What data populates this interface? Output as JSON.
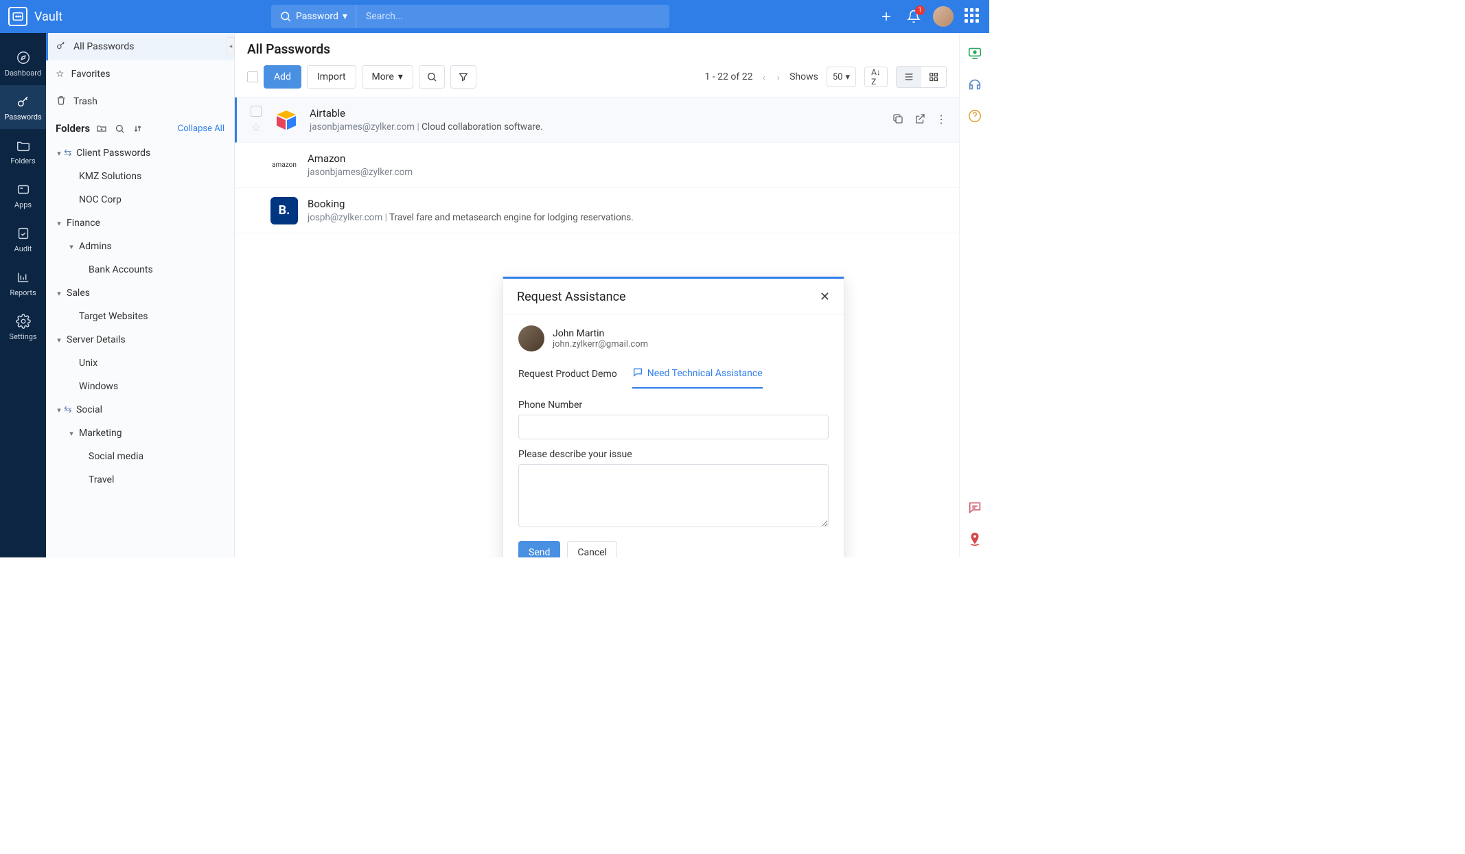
{
  "app": {
    "name": "Vault"
  },
  "search": {
    "type_label": "Password",
    "placeholder": "Search..."
  },
  "topbar": {
    "notification_count": "1"
  },
  "nav_rail": [
    {
      "label": "Dashboard"
    },
    {
      "label": "Passwords"
    },
    {
      "label": "Folders"
    },
    {
      "label": "Apps"
    },
    {
      "label": "Audit"
    },
    {
      "label": "Reports"
    },
    {
      "label": "Settings"
    }
  ],
  "sidebar": {
    "items": [
      {
        "label": "All Passwords"
      },
      {
        "label": "Favorites"
      },
      {
        "label": "Trash"
      }
    ],
    "folders_title": "Folders",
    "collapse_label": "Collapse All",
    "tree": {
      "client_passwords": "Client Passwords",
      "kmz": "KMZ Solutions",
      "noc": "NOC Corp",
      "finance": "Finance",
      "admins": "Admins",
      "bank": "Bank Accounts",
      "sales": "Sales",
      "target": "Target Websites",
      "server": "Server Details",
      "unix": "Unix",
      "windows": "Windows",
      "social": "Social",
      "marketing": "Marketing",
      "social_media": "Social media",
      "travel": "Travel"
    }
  },
  "content": {
    "title": "All Passwords",
    "toolbar": {
      "add": "Add",
      "import": "Import",
      "more": "More"
    },
    "pager": {
      "range": "1 - 22 of 22",
      "shows": "Shows",
      "size": "50"
    },
    "items": [
      {
        "title": "Airtable",
        "email": "jasonbjames@zylker.com",
        "desc": "Cloud collaboration software.",
        "icon_bg": "#fff",
        "icon_text": "",
        "icon_style": "airtable"
      },
      {
        "title": "Amazon",
        "email": "jasonbjames@zylker.com",
        "desc": "",
        "icon_text": "amazon"
      },
      {
        "title": "Booking",
        "email": "josph@zylker.com",
        "desc": "Travel fare and metasearch engine for lodging reservations.",
        "icon_bg": "#003580",
        "icon_text": "B."
      }
    ]
  },
  "modal": {
    "title": "Request Assistance",
    "user_name": "John Martin",
    "user_email": "john.zylkerr@gmail.com",
    "tabs": {
      "demo": "Request Product Demo",
      "tech": "Need Technical Assistance"
    },
    "field_phone": "Phone Number",
    "field_issue": "Please describe your issue",
    "send": "Send",
    "cancel": "Cancel"
  }
}
